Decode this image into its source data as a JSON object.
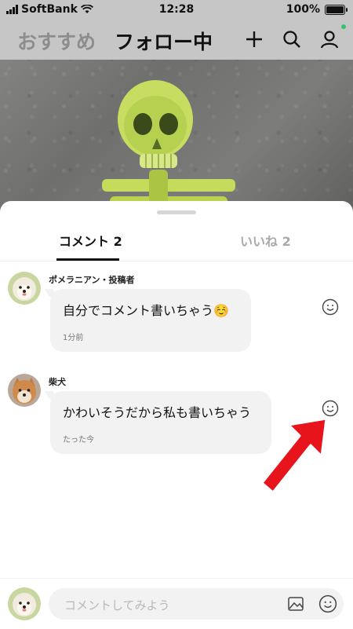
{
  "status_bar": {
    "carrier": "SoftBank",
    "time": "12:28",
    "battery": "100%",
    "battery_level": 1.0
  },
  "top_nav": {
    "tab_recommended": "おすすめ",
    "tab_following": "フォロー中",
    "icons": [
      "plus-icon",
      "search-icon",
      "profile-icon"
    ],
    "notification_dot_color": "#34c36b"
  },
  "sheet": {
    "tabs": [
      {
        "label": "コメント 2",
        "active": true
      },
      {
        "label": "いいね 2",
        "active": false
      }
    ]
  },
  "comments": [
    {
      "author": "ポメラニアン・投稿者",
      "text": "自分でコメント書いちゃう☺️",
      "time": "1分前",
      "avatar": "pomeranian"
    },
    {
      "author": "柴犬",
      "text": "かわいそうだから私も書いちゃう",
      "time": "たった今",
      "avatar": "shiba"
    }
  ],
  "comment_input": {
    "placeholder": "コメントしてみよう",
    "icons": [
      "image-icon",
      "emoji-icon"
    ]
  },
  "annotation": {
    "arrow_color": "#e8141c"
  }
}
